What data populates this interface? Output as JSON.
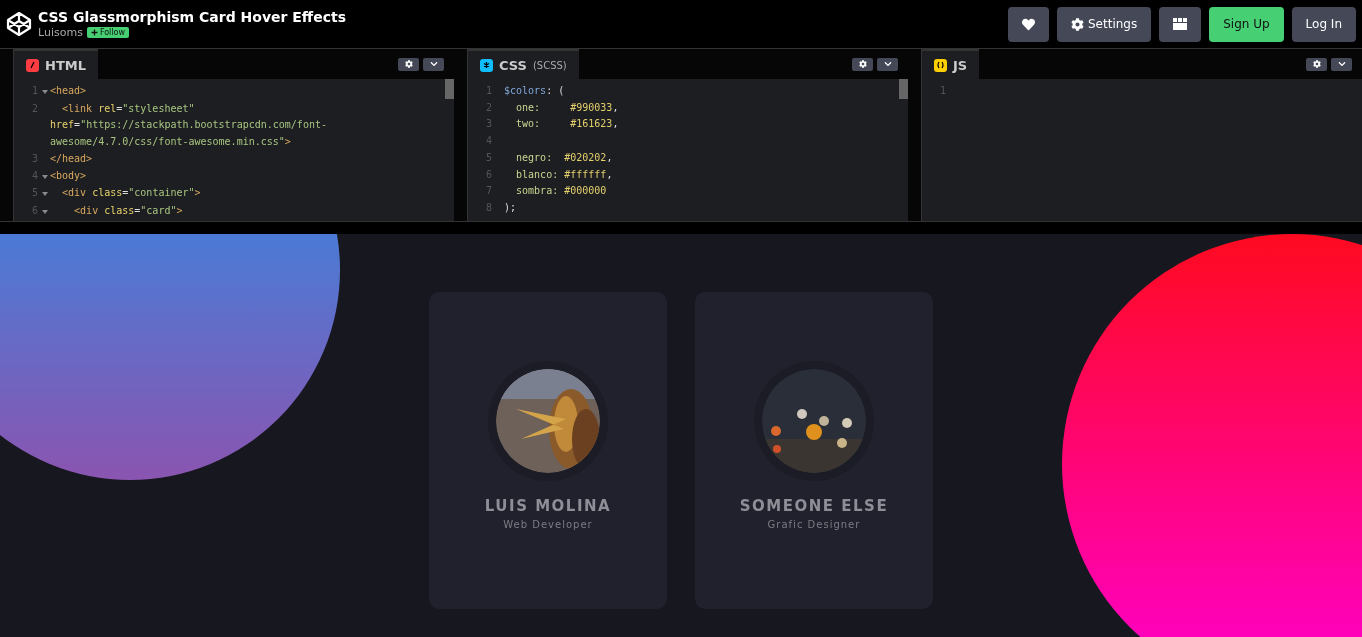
{
  "header": {
    "title": "CSS Glassmorphism Card Hover Effects",
    "author": "Luisoms",
    "follow": "Follow",
    "buttons": [
      {
        "kind": "heart"
      },
      {
        "kind": "settings",
        "label": "Settings"
      },
      {
        "kind": "layout"
      },
      {
        "kind": "signup",
        "label": "Sign Up"
      },
      {
        "kind": "login",
        "label": "Log In"
      }
    ]
  },
  "editors": [
    {
      "kind": "html",
      "name": "HTML",
      "lines": [
        {
          "number": "1",
          "fold": true,
          "tokens": [
            {
              "kind": "tag",
              "text": "<head>"
            }
          ]
        },
        {
          "number": "2",
          "fold": false,
          "tokens": [
            {
              "kind": "tag",
              "text": "  <link "
            },
            {
              "kind": "attr",
              "text": "rel"
            },
            {
              "kind": "plain",
              "text": "="
            },
            {
              "kind": "string",
              "text": "\"stylesheet\""
            }
          ]
        },
        {
          "fold": false,
          "tokens": [
            {
              "kind": "attr",
              "text": "href"
            },
            {
              "kind": "plain",
              "text": "="
            },
            {
              "kind": "string",
              "text": "\"https://stackpath.bootstrapcdn.com/font-"
            }
          ]
        },
        {
          "fold": false,
          "tokens": [
            {
              "kind": "string",
              "text": "awesome/4.7.0/css/font-awesome.min.css\""
            },
            {
              "kind": "tag",
              "text": ">"
            }
          ]
        },
        {
          "number": "3",
          "fold": false,
          "tokens": [
            {
              "kind": "tag",
              "text": "</head>"
            }
          ]
        },
        {
          "number": "4",
          "fold": true,
          "tokens": [
            {
              "kind": "tag",
              "text": "<body>"
            }
          ]
        },
        {
          "number": "5",
          "fold": true,
          "tokens": [
            {
              "kind": "tag",
              "text": "  <div "
            },
            {
              "kind": "attr",
              "text": "class"
            },
            {
              "kind": "plain",
              "text": "="
            },
            {
              "kind": "string",
              "text": "\"container\""
            },
            {
              "kind": "tag",
              "text": ">"
            }
          ]
        },
        {
          "number": "6",
          "fold": true,
          "tokens": [
            {
              "kind": "tag",
              "text": "    <div "
            },
            {
              "kind": "attr",
              "text": "class"
            },
            {
              "kind": "plain",
              "text": "="
            },
            {
              "kind": "string",
              "text": "\"card\""
            },
            {
              "kind": "tag",
              "text": ">"
            }
          ]
        }
      ]
    },
    {
      "kind": "css",
      "name": "CSS",
      "sub": "(SCSS)",
      "lines": [
        {
          "number": "1",
          "fold": false,
          "tokens": [
            {
              "kind": "var",
              "text": "$colors"
            },
            {
              "kind": "plain",
              "text": ": ("
            }
          ]
        },
        {
          "number": "2",
          "fold": false,
          "tokens": [
            {
              "kind": "prop",
              "text": "  one:     "
            },
            {
              "kind": "value",
              "text": "#990033"
            },
            {
              "kind": "plain",
              "text": ","
            }
          ]
        },
        {
          "number": "3",
          "fold": false,
          "tokens": [
            {
              "kind": "prop",
              "text": "  two:     "
            },
            {
              "kind": "value",
              "text": "#161623"
            },
            {
              "kind": "plain",
              "text": ","
            }
          ]
        },
        {
          "number": "4",
          "fold": false
        },
        {
          "number": "5",
          "fold": false,
          "tokens": [
            {
              "kind": "prop",
              "text": "  negro:  "
            },
            {
              "kind": "value",
              "text": "#020202"
            },
            {
              "kind": "plain",
              "text": ","
            }
          ]
        },
        {
          "number": "6",
          "fold": false,
          "tokens": [
            {
              "kind": "prop",
              "text": "  blanco: "
            },
            {
              "kind": "value",
              "text": "#ffffff"
            },
            {
              "kind": "plain",
              "text": ","
            }
          ]
        },
        {
          "number": "7",
          "fold": false,
          "tokens": [
            {
              "kind": "prop",
              "text": "  sombra: "
            },
            {
              "kind": "value",
              "text": "#000000"
            }
          ]
        },
        {
          "number": "8",
          "fold": false,
          "tokens": [
            {
              "kind": "plain",
              "text": ");"
            }
          ]
        }
      ]
    },
    {
      "kind": "js",
      "name": "JS",
      "lines": [
        {
          "number": "1",
          "fold": false
        }
      ]
    }
  ],
  "preview": {
    "cards": [
      {
        "name": "LUIS MOLINA",
        "role": "Web Developer"
      },
      {
        "name": "SOMEONE ELSE",
        "role": "Grafic Designer"
      }
    ]
  }
}
